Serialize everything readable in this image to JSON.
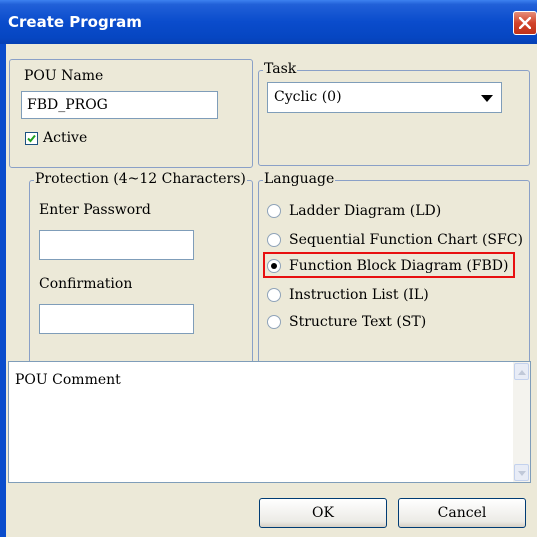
{
  "dialog": {
    "title": "Create Program"
  },
  "pou_name": {
    "label": "POU Name",
    "value": "FBD_PROG"
  },
  "active": {
    "label": "Active",
    "checked": true
  },
  "task": {
    "legend": "Task",
    "selected": "Cyclic (0)"
  },
  "protection": {
    "legend": "Protection (4~12 Characters)",
    "password_label": "Enter Password",
    "password_value": "",
    "confirmation_label": "Confirmation",
    "confirmation_value": ""
  },
  "language": {
    "legend": "Language",
    "options": [
      {
        "label": "Ladder Diagram (LD)",
        "selected": false
      },
      {
        "label": "Sequential Function Chart (SFC)",
        "selected": false
      },
      {
        "label": "Function Block Diagram (FBD)",
        "selected": true
      },
      {
        "label": "Instruction List (IL)",
        "selected": false
      },
      {
        "label": "Structure Text (ST)",
        "selected": false
      }
    ]
  },
  "comment": {
    "text": "POU Comment"
  },
  "buttons": {
    "ok": "OK",
    "cancel": "Cancel"
  },
  "colors": {
    "title_bar": "#0a4ccc",
    "highlight": "#e81010",
    "dialog_face": "#ece9d8"
  }
}
